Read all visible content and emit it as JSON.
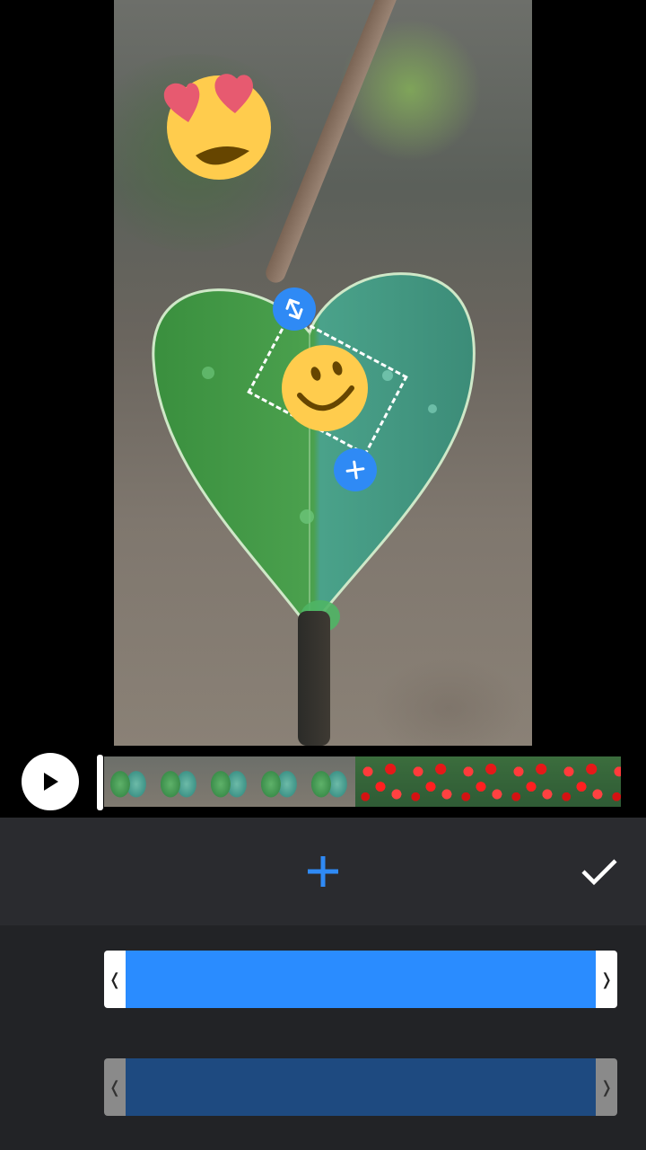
{
  "preview": {
    "stickers": [
      {
        "name": "heart-eyes-emoji",
        "glyph": "😍"
      },
      {
        "name": "smiley-emoji",
        "glyph": "🙂"
      }
    ],
    "handles": {
      "scale_icon": "resize-arrows-icon",
      "add_icon": "plus-icon"
    }
  },
  "timeline": {
    "play_icon": "play-icon",
    "frames": [
      "leaf",
      "leaf",
      "leaf",
      "leaf",
      "leaf",
      "flower",
      "flower",
      "flower",
      "flower",
      "flower",
      "flower"
    ]
  },
  "toolbar": {
    "add_icon": "plus-icon",
    "confirm_icon": "checkmark-icon"
  },
  "tracks": [
    {
      "name": "sticker-track-selected",
      "color": "#2a8cff",
      "grip_color": "#ffffff",
      "grip_text_color": "#222222",
      "left_grip": "❬",
      "right_grip": "❭"
    },
    {
      "name": "sticker-track-inactive",
      "color": "#1e4a80",
      "grip_color": "#8a8a8a",
      "grip_text_color": "#333333",
      "left_grip": "❬",
      "right_grip": "❭"
    }
  ],
  "colors": {
    "accent": "#2f8af5",
    "toolbar_bg": "#2a2b2f",
    "tracks_bg": "#222326"
  }
}
